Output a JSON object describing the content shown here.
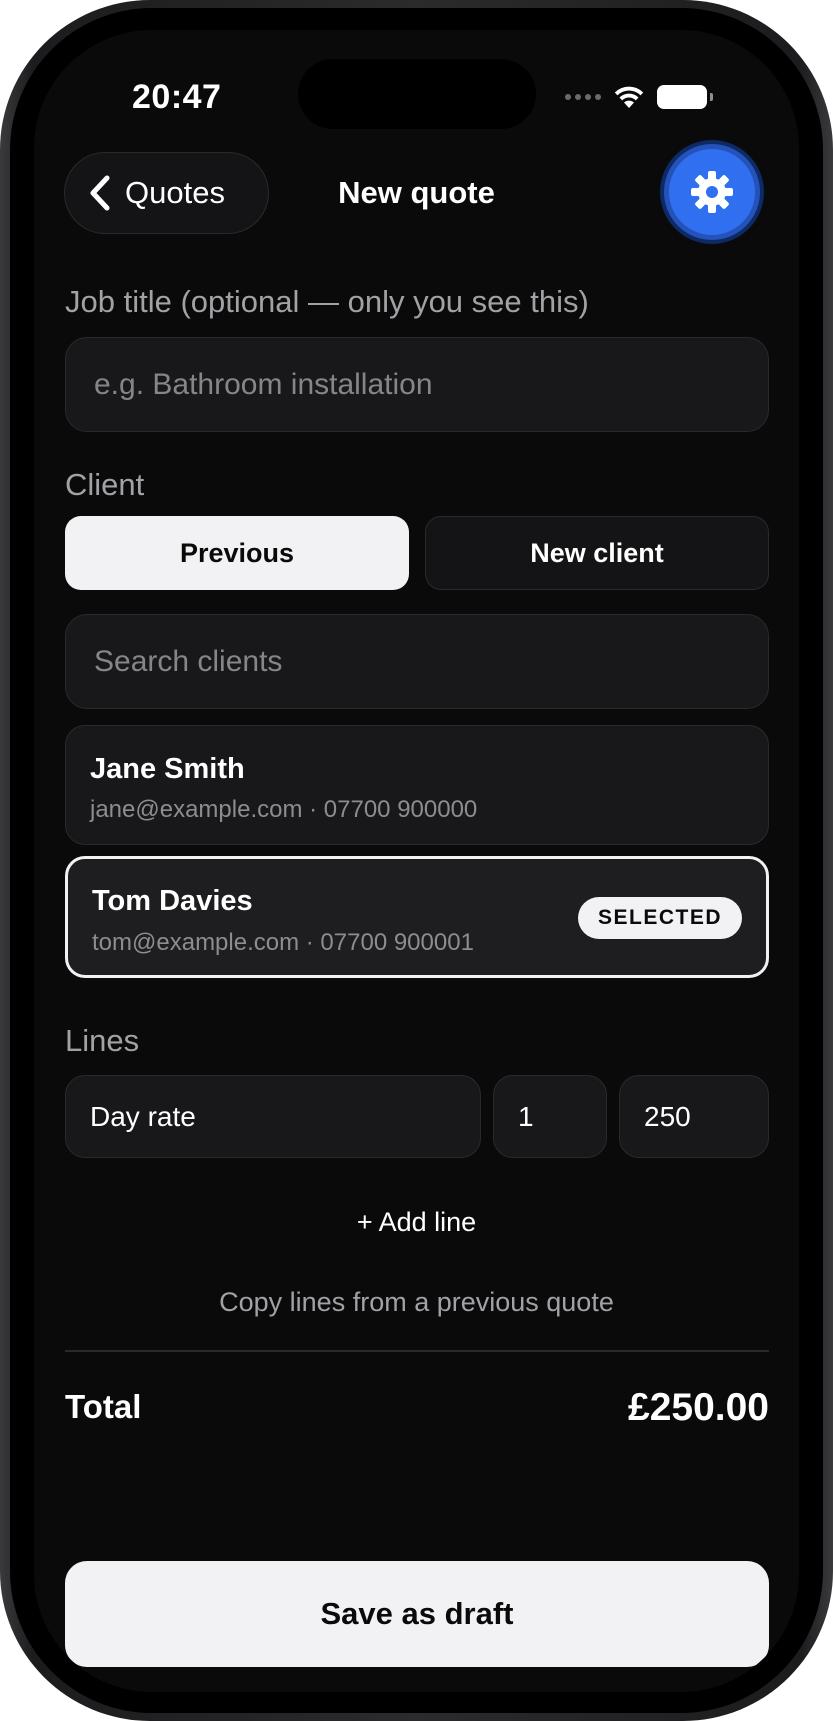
{
  "status_bar": {
    "time": "20:47"
  },
  "nav": {
    "back_label": "Quotes",
    "title": "New quote"
  },
  "job_title": {
    "label": "Job title (optional — only you see this)",
    "placeholder": "e.g. Bathroom installation",
    "value": ""
  },
  "client": {
    "label": "Client",
    "segments": [
      {
        "label": "Previous",
        "active": true
      },
      {
        "label": "New client",
        "active": false
      }
    ],
    "search_placeholder": "Search clients",
    "list": [
      {
        "name": "Jane Smith",
        "detail": "jane@example.com · 07700 900000",
        "selected": false
      },
      {
        "name": "Tom Davies",
        "detail": "tom@example.com · 07700 900001",
        "selected": true,
        "badge": "SELECTED"
      }
    ]
  },
  "lines": {
    "label": "Lines",
    "items": [
      {
        "description": "Day rate",
        "quantity": "1",
        "price": "250"
      }
    ],
    "add_line_label": "+ Add line",
    "copy_lines_label": "Copy lines from a previous quote"
  },
  "total": {
    "label": "Total",
    "value": "£250.00"
  },
  "save_button": "Save as draft",
  "colors": {
    "background": "#0a0a0a",
    "accent": "#2f6ff0",
    "field_bg": "#18181b",
    "selected_border": "#f2f2f4"
  }
}
